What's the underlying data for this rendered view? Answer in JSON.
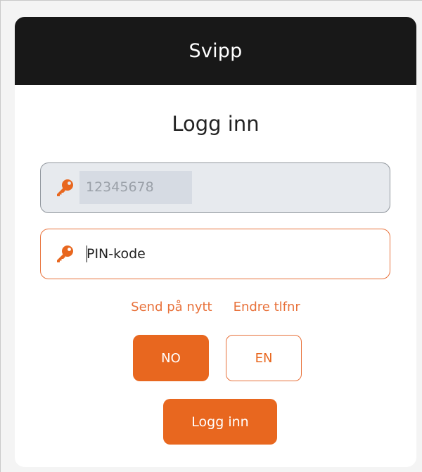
{
  "header": {
    "title": "Svipp"
  },
  "form": {
    "heading": "Logg inn",
    "phone": {
      "value": "12345678",
      "icon": "key-icon"
    },
    "pin": {
      "placeholder": "PIN-kode",
      "icon": "key-icon"
    }
  },
  "links": {
    "resend": "Send på nytt",
    "change_phone": "Endre tlfnr"
  },
  "language": {
    "no": "NO",
    "en": "EN",
    "selected": "NO"
  },
  "login_button": "Logg inn",
  "colors": {
    "accent": "#e8671f",
    "header_bg": "#181818",
    "phone_field_bg": "#e7eaee"
  }
}
